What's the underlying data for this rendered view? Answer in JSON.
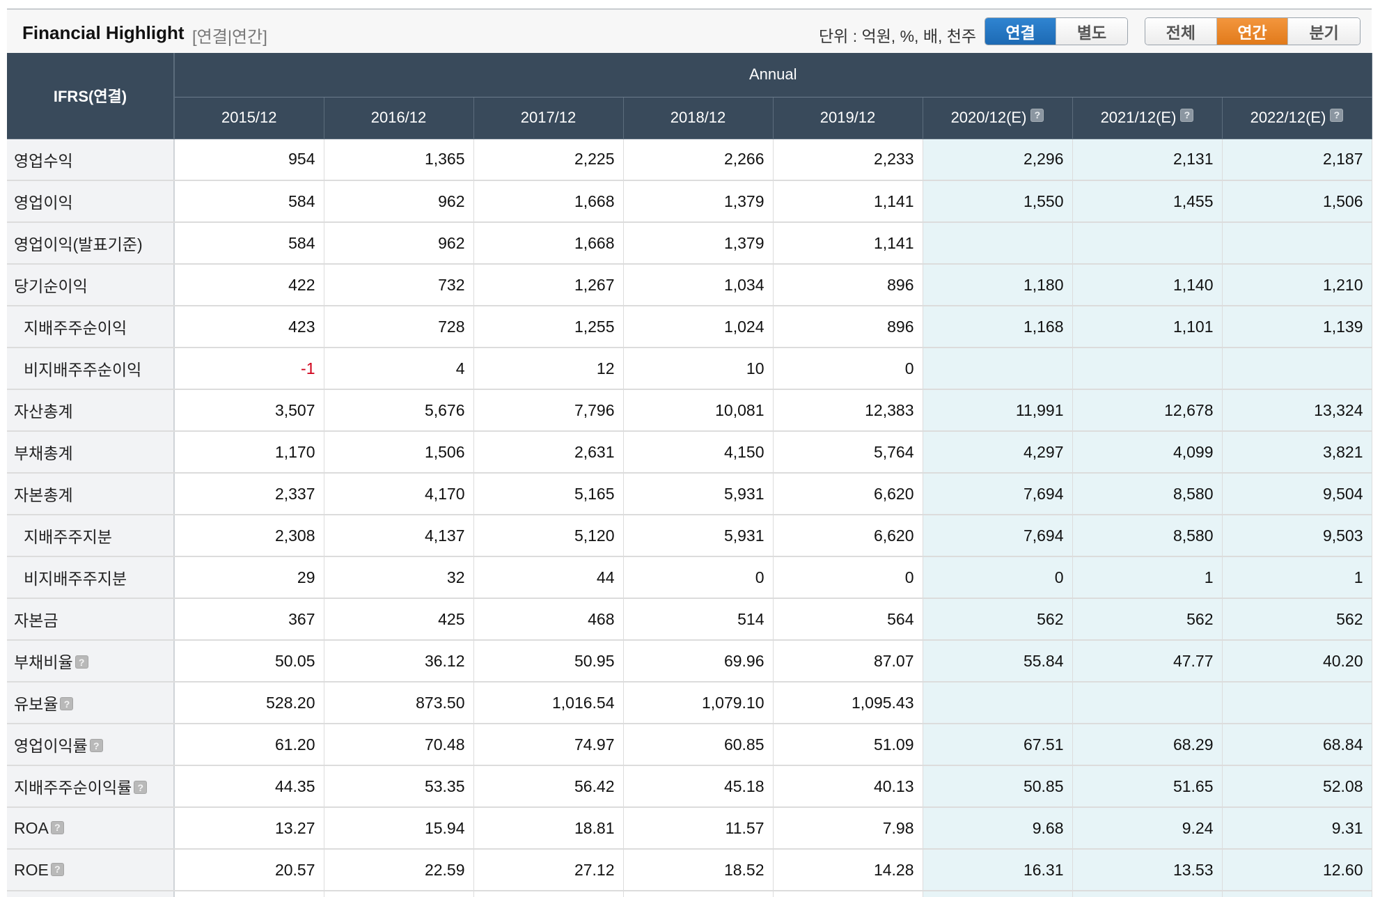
{
  "header": {
    "title": "Financial Highlight",
    "subtitle": "[연결|연간]",
    "unit_text": "단위 : 억원, %, 배, 천주",
    "scope_buttons": [
      "연결",
      "별도"
    ],
    "scope_selected": "연결",
    "period_buttons": [
      "전체",
      "연간",
      "분기"
    ],
    "period_selected": "연간"
  },
  "table": {
    "corner_label": "IFRS(연결)",
    "group_label": "Annual",
    "columns": [
      {
        "label": "2015/12",
        "estimate": false
      },
      {
        "label": "2016/12",
        "estimate": false
      },
      {
        "label": "2017/12",
        "estimate": false
      },
      {
        "label": "2018/12",
        "estimate": false
      },
      {
        "label": "2019/12",
        "estimate": false
      },
      {
        "label": "2020/12(E)",
        "estimate": true
      },
      {
        "label": "2021/12(E)",
        "estimate": true
      },
      {
        "label": "2022/12(E)",
        "estimate": true
      }
    ],
    "rows": [
      {
        "label": "영업수익",
        "indent": false,
        "help": false,
        "values": [
          "954",
          "1,365",
          "2,225",
          "2,266",
          "2,233",
          "2,296",
          "2,131",
          "2,187"
        ]
      },
      {
        "label": "영업이익",
        "indent": false,
        "help": false,
        "values": [
          "584",
          "962",
          "1,668",
          "1,379",
          "1,141",
          "1,550",
          "1,455",
          "1,506"
        ]
      },
      {
        "label": "영업이익(발표기준)",
        "indent": false,
        "help": false,
        "values": [
          "584",
          "962",
          "1,668",
          "1,379",
          "1,141",
          "",
          "",
          ""
        ]
      },
      {
        "label": "당기순이익",
        "indent": false,
        "help": false,
        "values": [
          "422",
          "732",
          "1,267",
          "1,034",
          "896",
          "1,180",
          "1,140",
          "1,210"
        ]
      },
      {
        "label": "지배주주순이익",
        "indent": true,
        "help": false,
        "values": [
          "423",
          "728",
          "1,255",
          "1,024",
          "896",
          "1,168",
          "1,101",
          "1,139"
        ]
      },
      {
        "label": "비지배주주순이익",
        "indent": true,
        "help": false,
        "values": [
          "-1",
          "4",
          "12",
          "10",
          "0",
          "",
          "",
          ""
        ]
      },
      {
        "label": "자산총계",
        "indent": false,
        "help": false,
        "values": [
          "3,507",
          "5,676",
          "7,796",
          "10,081",
          "12,383",
          "11,991",
          "12,678",
          "13,324"
        ]
      },
      {
        "label": "부채총계",
        "indent": false,
        "help": false,
        "values": [
          "1,170",
          "1,506",
          "2,631",
          "4,150",
          "5,764",
          "4,297",
          "4,099",
          "3,821"
        ]
      },
      {
        "label": "자본총계",
        "indent": false,
        "help": false,
        "values": [
          "2,337",
          "4,170",
          "5,165",
          "5,931",
          "6,620",
          "7,694",
          "8,580",
          "9,504"
        ]
      },
      {
        "label": "지배주주지분",
        "indent": true,
        "help": false,
        "values": [
          "2,308",
          "4,137",
          "5,120",
          "5,931",
          "6,620",
          "7,694",
          "8,580",
          "9,503"
        ]
      },
      {
        "label": "비지배주주지분",
        "indent": true,
        "help": false,
        "values": [
          "29",
          "32",
          "44",
          "0",
          "0",
          "0",
          "1",
          "1"
        ]
      },
      {
        "label": "자본금",
        "indent": false,
        "help": false,
        "values": [
          "367",
          "425",
          "468",
          "514",
          "564",
          "562",
          "562",
          "562"
        ]
      },
      {
        "label": "부채비율",
        "indent": false,
        "help": true,
        "values": [
          "50.05",
          "36.12",
          "50.95",
          "69.96",
          "87.07",
          "55.84",
          "47.77",
          "40.20"
        ]
      },
      {
        "label": "유보율",
        "indent": false,
        "help": true,
        "values": [
          "528.20",
          "873.50",
          "1,016.54",
          "1,079.10",
          "1,095.43",
          "",
          "",
          ""
        ]
      },
      {
        "label": "영업이익률",
        "indent": false,
        "help": true,
        "values": [
          "61.20",
          "70.48",
          "74.97",
          "60.85",
          "51.09",
          "67.51",
          "68.29",
          "68.84"
        ]
      },
      {
        "label": "지배주주순이익률",
        "indent": false,
        "help": true,
        "values": [
          "44.35",
          "53.35",
          "56.42",
          "45.18",
          "40.13",
          "50.85",
          "51.65",
          "52.08"
        ]
      },
      {
        "label": "ROA",
        "indent": false,
        "help": true,
        "values": [
          "13.27",
          "15.94",
          "18.81",
          "11.57",
          "7.98",
          "9.68",
          "9.24",
          "9.31"
        ]
      },
      {
        "label": "ROE",
        "indent": false,
        "help": true,
        "values": [
          "20.57",
          "22.59",
          "27.12",
          "18.52",
          "14.28",
          "16.31",
          "13.53",
          "12.60"
        ]
      }
    ]
  },
  "colors": {
    "header_bg": "#394a5b",
    "estimate_bg": "#e7f4f7",
    "label_bg": "#f2f3f5",
    "active_blue": "#1d6ab4",
    "active_orange": "#e17a1b",
    "negative": "#d0021b"
  },
  "icons": {
    "help": "question-mark-icon"
  }
}
